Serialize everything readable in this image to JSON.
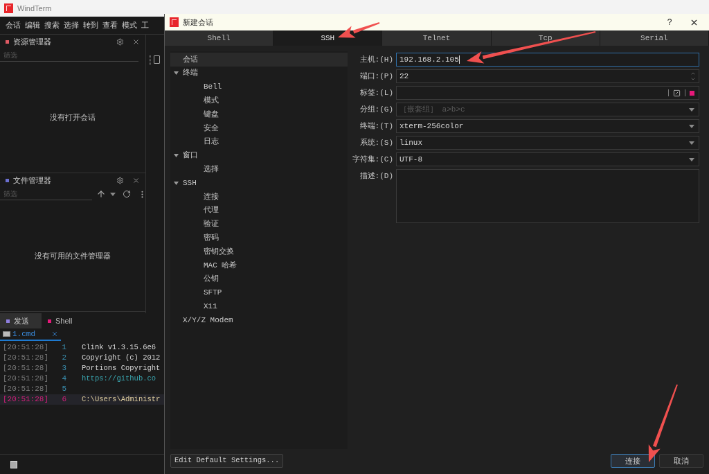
{
  "app": {
    "title": "WindTerm",
    "menu": [
      "会话",
      "编辑",
      "搜索",
      "选择",
      "转到",
      "查看",
      "模式",
      "工"
    ]
  },
  "explorer": {
    "title": "资源管理器",
    "color": "#e05a64",
    "filter_placeholder": "筛选",
    "empty_text": "没有打开会话"
  },
  "file_manager": {
    "title": "文件管理器",
    "color": "#6b6fd0",
    "filter_placeholder": "筛选",
    "empty_text": "没有可用的文件管理器"
  },
  "bottom_panel": {
    "tabs": [
      {
        "label": "发送",
        "selected": true,
        "color": "#8f7fe0"
      },
      {
        "label": "Shell",
        "selected": false,
        "color": "#e6197a"
      }
    ],
    "session_tab": {
      "label": "1.cmd"
    },
    "lines": [
      {
        "time": "[20:51:28]",
        "number": "1",
        "text": "Clink v1.3.15.6e6",
        "kind": "plain",
        "active": false
      },
      {
        "time": "[20:51:28]",
        "number": "2",
        "text": "Copyright (c) 2012",
        "kind": "plain",
        "active": false
      },
      {
        "time": "[20:51:28]",
        "number": "3",
        "text": "Portions Copyright",
        "kind": "plain",
        "active": false
      },
      {
        "time": "[20:51:28]",
        "number": "4",
        "text": "https://github.co",
        "kind": "link",
        "active": false
      },
      {
        "time": "[20:51:28]",
        "number": "5",
        "active": false
      },
      {
        "time": "[20:51:28]",
        "number": "6",
        "text": "C:\\Users\\Administr",
        "kind": "plain",
        "active": true
      }
    ]
  },
  "dialog": {
    "title": "新建会话",
    "help": "?",
    "tabs": [
      {
        "label": "Shell",
        "selected": false
      },
      {
        "label": "SSH",
        "selected": true
      },
      {
        "label": "Telnet",
        "selected": false
      },
      {
        "label": "Tcp",
        "selected": false
      },
      {
        "label": "Serial",
        "selected": false
      }
    ],
    "tree": [
      {
        "label": "会话",
        "selected": true
      },
      {
        "label": "终端",
        "selected": false,
        "expanded": true,
        "children": [
          {
            "label": "Bell",
            "selected": false
          },
          {
            "label": "模式",
            "selected": false
          },
          {
            "label": "键盘",
            "selected": false
          },
          {
            "label": "安全",
            "selected": false
          },
          {
            "label": "日志",
            "selected": false
          }
        ]
      },
      {
        "label": "窗口",
        "selected": false,
        "expanded": true,
        "children": [
          {
            "label": "选择",
            "selected": false
          }
        ]
      },
      {
        "label": "SSH",
        "selected": false,
        "expanded": true,
        "children": [
          {
            "label": "连接",
            "selected": false
          },
          {
            "label": "代理",
            "selected": false
          },
          {
            "label": "验证",
            "selected": false
          },
          {
            "label": "密码",
            "selected": false
          },
          {
            "label": "密钥交换",
            "selected": false
          },
          {
            "label": "MAC 哈希",
            "selected": false
          },
          {
            "label": "公钥",
            "selected": false
          },
          {
            "label": "SFTP",
            "selected": false
          },
          {
            "label": "X11",
            "selected": false
          }
        ]
      },
      {
        "label": "X/Y/Z Modem",
        "selected": false
      }
    ],
    "fields": [
      {
        "label": "主机:(H)",
        "kind": "text",
        "value": "192.168.2.105",
        "focused": true
      },
      {
        "label": "端口:(P)",
        "kind": "spin",
        "value": "22",
        "focused": false
      },
      {
        "label": "标签:(L)",
        "kind": "tag",
        "color": "#e6197a",
        "focused": false
      },
      {
        "label": "分组:(G)",
        "kind": "combo",
        "placeholder": "［嵌套组］ a>b>c",
        "focused": false
      },
      {
        "label": "终端:(T)",
        "kind": "combo",
        "value": "xterm-256color",
        "focused": false
      },
      {
        "label": "系统:(S)",
        "kind": "combo",
        "value": "linux",
        "focused": false
      },
      {
        "label": "字符集:(C)",
        "kind": "combo",
        "value": "UTF-8",
        "focused": false
      },
      {
        "label": "描述:(D)",
        "kind": "textarea",
        "focused": false
      }
    ],
    "edit_defaults_button": "Edit Default Settings...",
    "buttons": [
      {
        "label": "连接",
        "default": true
      },
      {
        "label": "取消",
        "default": false
      }
    ]
  }
}
